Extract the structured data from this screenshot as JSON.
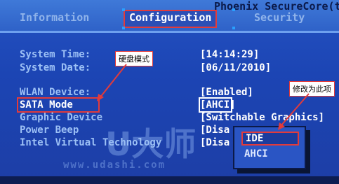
{
  "header": {
    "vendor": "Phoenix SecureCore(tm) Setup U",
    "tabs": [
      {
        "label": "Information"
      },
      {
        "label": "Configuration"
      },
      {
        "label": "Security"
      }
    ]
  },
  "settings": {
    "system_time": {
      "label": "System Time:",
      "value": "[14:14:29]"
    },
    "system_date": {
      "label": "System Date:",
      "value": "[06/11/2010]"
    },
    "wlan": {
      "label": "WLAN Device:",
      "value": "[Enabled]"
    },
    "sata": {
      "label": "SATA Mode",
      "value_prefix": "[",
      "value": "AHCI",
      "value_suffix": "]"
    },
    "graphic": {
      "label": "Graphic Device",
      "value": "[Switchable Graphics]"
    },
    "power_beep": {
      "label": "Power Beep",
      "value": "[Disa"
    },
    "intel_vt": {
      "label": "Intel Virtual Technology",
      "value": "[Disa"
    }
  },
  "popup": {
    "options": [
      "IDE",
      "AHCI"
    ],
    "selected": "IDE"
  },
  "annotations": {
    "sata_callout": "硬盘模式",
    "ide_callout": "修改为此项"
  },
  "watermark": {
    "brand": "U大师",
    "url": "www.udashi.com"
  },
  "colors": {
    "background": "#1d45b4",
    "highlight_red": "#e23b3b",
    "text_white": "#ffffff"
  }
}
